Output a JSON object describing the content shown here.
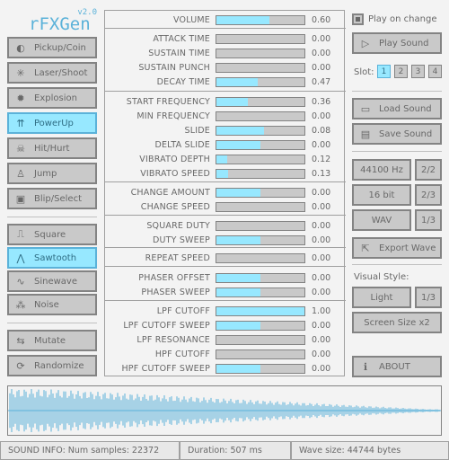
{
  "app": {
    "name": "rFXGen",
    "version": "v2.0"
  },
  "generators": [
    {
      "label": "Pickup/Coin",
      "icon": "coin-icon",
      "glyph": "◐",
      "active": false
    },
    {
      "label": "Laser/Shoot",
      "icon": "laser-icon",
      "glyph": "✳",
      "active": false
    },
    {
      "label": "Explosion",
      "icon": "explosion-icon",
      "glyph": "✹",
      "active": false
    },
    {
      "label": "PowerUp",
      "icon": "powerup-icon",
      "glyph": "⇈",
      "active": true
    },
    {
      "label": "Hit/Hurt",
      "icon": "skull-icon",
      "glyph": "☠",
      "active": false
    },
    {
      "label": "Jump",
      "icon": "jump-icon",
      "glyph": "♙",
      "active": false
    },
    {
      "label": "Blip/Select",
      "icon": "blip-icon",
      "glyph": "▣",
      "active": false
    }
  ],
  "waveforms": [
    {
      "label": "Square",
      "icon": "square-wave-icon",
      "glyph": "⎍",
      "active": false
    },
    {
      "label": "Sawtooth",
      "icon": "sawtooth-wave-icon",
      "glyph": "⋀",
      "active": true
    },
    {
      "label": "Sinewave",
      "icon": "sine-wave-icon",
      "glyph": "∿",
      "active": false
    },
    {
      "label": "Noise",
      "icon": "noise-icon",
      "glyph": "⁂",
      "active": false
    }
  ],
  "actions": {
    "mutate": {
      "label": "Mutate",
      "icon": "mutate-icon",
      "glyph": "⇆"
    },
    "randomize": {
      "label": "Randomize",
      "icon": "randomize-icon",
      "glyph": "⟳"
    }
  },
  "params": [
    {
      "label": "VOLUME",
      "value": "0.60",
      "level": 0.6
    },
    {
      "label": "ATTACK TIME",
      "value": "0.00",
      "level": 0.0
    },
    {
      "label": "SUSTAIN TIME",
      "value": "0.00",
      "level": 0.0
    },
    {
      "label": "SUSTAIN PUNCH",
      "value": "0.00",
      "level": 0.0
    },
    {
      "label": "DECAY TIME",
      "value": "0.47",
      "level": 0.47
    },
    {
      "label": "START FREQUENCY",
      "value": "0.36",
      "level": 0.36
    },
    {
      "label": "MIN FREQUENCY",
      "value": "0.00",
      "level": 0.0
    },
    {
      "label": "SLIDE",
      "value": "0.08",
      "level": 0.54
    },
    {
      "label": "DELTA SLIDE",
      "value": "0.00",
      "level": 0.5
    },
    {
      "label": "VIBRATO DEPTH",
      "value": "0.12",
      "level": 0.12
    },
    {
      "label": "VIBRATO SPEED",
      "value": "0.13",
      "level": 0.13
    },
    {
      "label": "CHANGE AMOUNT",
      "value": "0.00",
      "level": 0.5
    },
    {
      "label": "CHANGE SPEED",
      "value": "0.00",
      "level": 0.0
    },
    {
      "label": "SQUARE DUTY",
      "value": "0.00",
      "level": 0.0
    },
    {
      "label": "DUTY SWEEP",
      "value": "0.00",
      "level": 0.5
    },
    {
      "label": "REPEAT SPEED",
      "value": "0.00",
      "level": 0.0
    },
    {
      "label": "PHASER OFFSET",
      "value": "0.00",
      "level": 0.5
    },
    {
      "label": "PHASER SWEEP",
      "value": "0.00",
      "level": 0.5
    },
    {
      "label": "LPF CUTOFF",
      "value": "1.00",
      "level": 1.0
    },
    {
      "label": "LPF CUTOFF SWEEP",
      "value": "0.00",
      "level": 0.5
    },
    {
      "label": "LPF RESONANCE",
      "value": "0.00",
      "level": 0.0
    },
    {
      "label": "HPF CUTOFF",
      "value": "0.00",
      "level": 0.0
    },
    {
      "label": "HPF CUTOFF SWEEP",
      "value": "0.00",
      "level": 0.5
    }
  ],
  "right": {
    "play_on_change": "Play on change",
    "play_sound": {
      "label": "Play Sound",
      "icon": "play-icon",
      "glyph": "▷"
    },
    "slot_label": "Slot:",
    "slots": [
      "1",
      "2",
      "3",
      "4"
    ],
    "active_slot": "1",
    "load_sound": {
      "label": "Load Sound",
      "icon": "folder-open-icon",
      "glyph": "▭"
    },
    "save_sound": {
      "label": "Save Sound",
      "icon": "save-icon",
      "glyph": "▤"
    },
    "sample_rate": "44100 Hz",
    "sample_rate_idx": "2/2",
    "bit_depth": "16 bit",
    "bit_depth_idx": "2/3",
    "format": "WAV",
    "format_idx": "1/3",
    "export_wave": {
      "label": "Export Wave",
      "icon": "export-icon",
      "glyph": "⇱"
    },
    "visual_style_label": "Visual Style:",
    "style": "Light",
    "style_idx": "1/3",
    "screen_size": "Screen Size x2",
    "about": {
      "label": "ABOUT",
      "icon": "info-icon",
      "glyph": "ℹ"
    }
  },
  "status": {
    "info": "SOUND INFO: Num samples: 22372",
    "duration": "Duration: 507 ms",
    "wave_size": "Wave size: 44744 bytes"
  },
  "colors": {
    "accent": "#97e8ff",
    "accent_border": "#5bb2d9",
    "base": "#c9c9c9",
    "border": "#838383",
    "text": "#686868"
  }
}
